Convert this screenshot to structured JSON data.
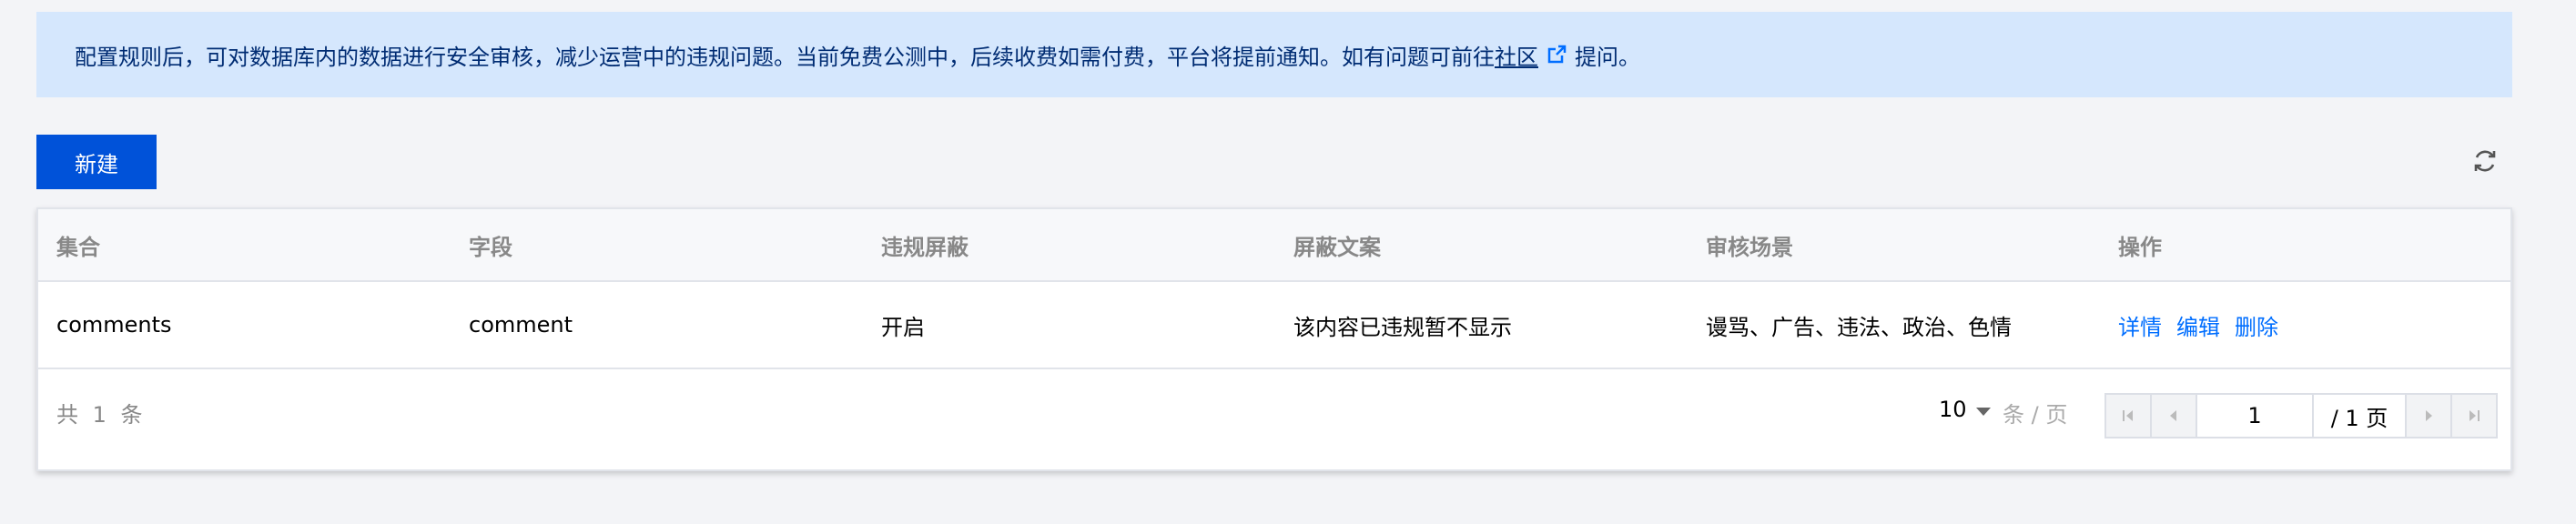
{
  "notice": {
    "text": "配置规则后，可对数据库内的数据进行安全审核，减少运营中的违规问题。当前免费公测中，后续收费如需付费，平台将提前通知。如有问题可前往",
    "link_label": "社区",
    "suffix": "提问。"
  },
  "toolbar": {
    "new_label": "新建"
  },
  "table": {
    "headers": [
      "集合",
      "字段",
      "违规屏蔽",
      "屏蔽文案",
      "审核场景",
      "操作"
    ],
    "rows": [
      {
        "collection": "comments",
        "field": "comment",
        "block": "开启",
        "block_text": "该内容已违规暂不显示",
        "scenes": "谩骂、广告、违法、政治、色情",
        "actions": [
          "详情",
          "编辑",
          "删除"
        ]
      }
    ]
  },
  "pagination": {
    "total_text": "共 1 条",
    "page_size": "10",
    "per_page_label": "条 / 页",
    "current_page": "1",
    "total_pages_text": "/ 1 页"
  },
  "colors": {
    "primary": "#0052d9",
    "link": "#006eff",
    "notice_bg": "#d5e7fd"
  }
}
